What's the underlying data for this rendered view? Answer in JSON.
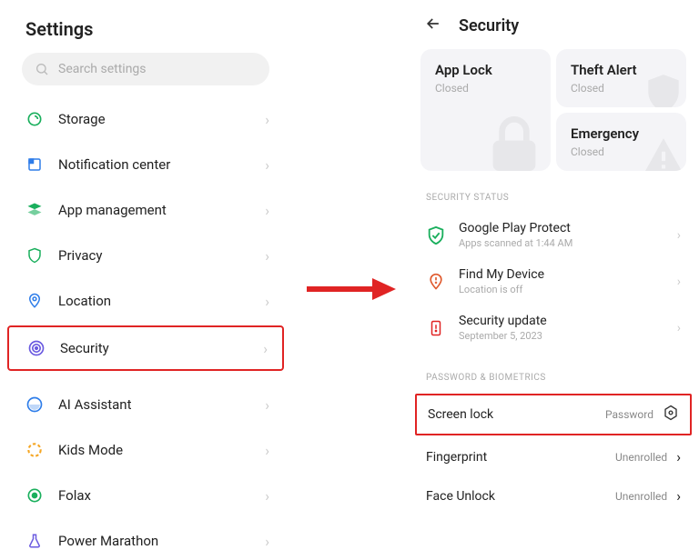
{
  "left": {
    "title": "Settings",
    "searchPlaceholder": "Search settings",
    "items": [
      {
        "label": "Storage",
        "iconColor": "#1aaf5d"
      },
      {
        "label": "Notification center",
        "iconColor": "#2e7de9"
      },
      {
        "label": "App management",
        "iconColor": "#1aaf5d"
      },
      {
        "label": "Privacy",
        "iconColor": "#1aaf5d"
      },
      {
        "label": "Location",
        "iconColor": "#2e7de9"
      },
      {
        "label": "Security",
        "iconColor": "#6a5ae0",
        "highlight": true
      },
      {
        "label": "AI Assistant",
        "iconColor": "#2e7de9"
      },
      {
        "label": "Kids Mode",
        "iconColor": "#f5a623"
      },
      {
        "label": "Folax",
        "iconColor": "#1aaf5d"
      },
      {
        "label": "Power Marathon",
        "iconColor": "#6a5ae0"
      }
    ]
  },
  "right": {
    "title": "Security",
    "cards": {
      "appLock": {
        "title": "App Lock",
        "status": "Closed"
      },
      "theftAlert": {
        "title": "Theft Alert",
        "status": "Closed"
      },
      "emergency": {
        "title": "Emergency",
        "status": "Closed"
      }
    },
    "statusLabel": "SECURITY STATUS",
    "statusItems": [
      {
        "title": "Google Play Protect",
        "sub": "Apps scanned at 1:44 AM"
      },
      {
        "title": "Find My Device",
        "sub": "Location is off"
      },
      {
        "title": "Security update",
        "sub": "September 5, 2023"
      }
    ],
    "pbLabel": "PASSWORD & BIOMETRICS",
    "pbItems": [
      {
        "label": "Screen lock",
        "status": "Password",
        "highlight": true,
        "gear": true
      },
      {
        "label": "Fingerprint",
        "status": "Unenrolled"
      },
      {
        "label": "Face Unlock",
        "status": "Unenrolled"
      }
    ]
  }
}
